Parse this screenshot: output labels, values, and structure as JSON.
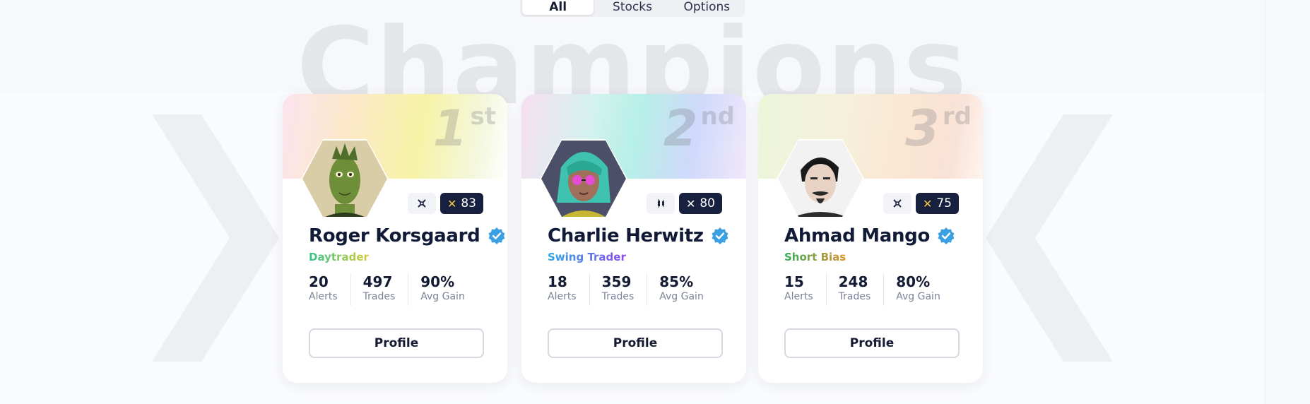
{
  "tabs": [
    {
      "label": "All",
      "active": true
    },
    {
      "label": "Stocks",
      "active": false
    },
    {
      "label": "Options",
      "active": false
    }
  ],
  "watermark": "Champions",
  "champions": [
    {
      "rank": "1",
      "rank_suffix": "st",
      "name": "Roger Korsgaard",
      "role": "Daytrader",
      "tool_icon": "crossed-tools-icon",
      "score": "83",
      "score_icon_color": "#f2c744",
      "stats": [
        {
          "value": "20",
          "label": "Alerts"
        },
        {
          "value": "497",
          "label": "Trades"
        },
        {
          "value": "90%",
          "label": "Avg Gain"
        }
      ],
      "button": "Profile"
    },
    {
      "rank": "2",
      "rank_suffix": "nd",
      "name": "Charlie Herwitz",
      "role": "Swing Trader",
      "tool_icon": "candlestick-icon",
      "score": "80",
      "score_icon_color": "#ffffff",
      "stats": [
        {
          "value": "18",
          "label": "Alerts"
        },
        {
          "value": "359",
          "label": "Trades"
        },
        {
          "value": "85%",
          "label": "Avg Gain"
        }
      ],
      "button": "Profile"
    },
    {
      "rank": "3",
      "rank_suffix": "rd",
      "name": "Ahmad Mango",
      "role": "Short Bias",
      "tool_icon": "crossed-tools-icon",
      "score": "75",
      "score_icon_color": "#f2c744",
      "stats": [
        {
          "value": "15",
          "label": "Alerts"
        },
        {
          "value": "248",
          "label": "Trades"
        },
        {
          "value": "80%",
          "label": "Avg Gain"
        }
      ],
      "button": "Profile"
    }
  ],
  "colors": {
    "navy": "#17203f",
    "verified_blue": "#3b9fe3",
    "gold": "#f2c744"
  }
}
